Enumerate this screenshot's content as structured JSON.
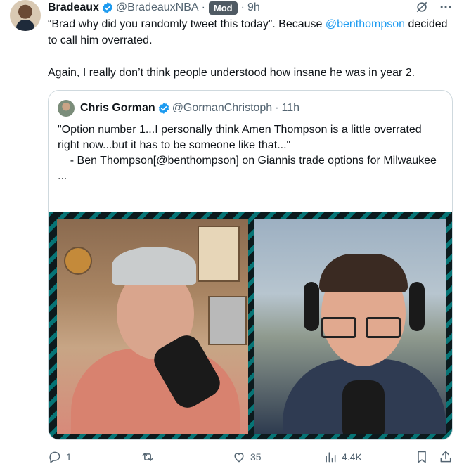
{
  "tweet": {
    "author_name": "Bradeaux",
    "author_handle": "@BradeauxNBA",
    "separator": "·",
    "badge": "Mod",
    "time": "9h",
    "text_part1": "“Brad why did you randomly tweet this today”. Because ",
    "text_mention": "@benthompson",
    "text_part2": " decided to call him overrated.",
    "text_para2": "Again, I really don’t think people understood how insane he was in year 2."
  },
  "quote": {
    "author_name": "Chris Gorman",
    "author_handle": "@GormanChristoph",
    "separator": "·",
    "time": "11h",
    "text": "\"Option number 1...I personally think Amen Thompson is a little overrated right now...but it has to be someone like that...\"\n    - Ben Thompson[@benthompson] on Giannis trade options for Milwaukee\n..."
  },
  "actions": {
    "replies": "1",
    "retweets": "",
    "likes": "35",
    "views": "4.4K"
  },
  "icons": {
    "verified": "verified-badge-icon",
    "grok": "grok-icon",
    "more": "more-icon",
    "reply": "reply-icon",
    "retweet": "retweet-icon",
    "like": "heart-icon",
    "views": "views-icon",
    "bookmark": "bookmark-icon",
    "share": "share-icon"
  },
  "colors": {
    "accent": "#1d9bf0",
    "secondary_text": "#536471",
    "border": "#cfd9de",
    "mod_badge": "#4f5a63"
  }
}
